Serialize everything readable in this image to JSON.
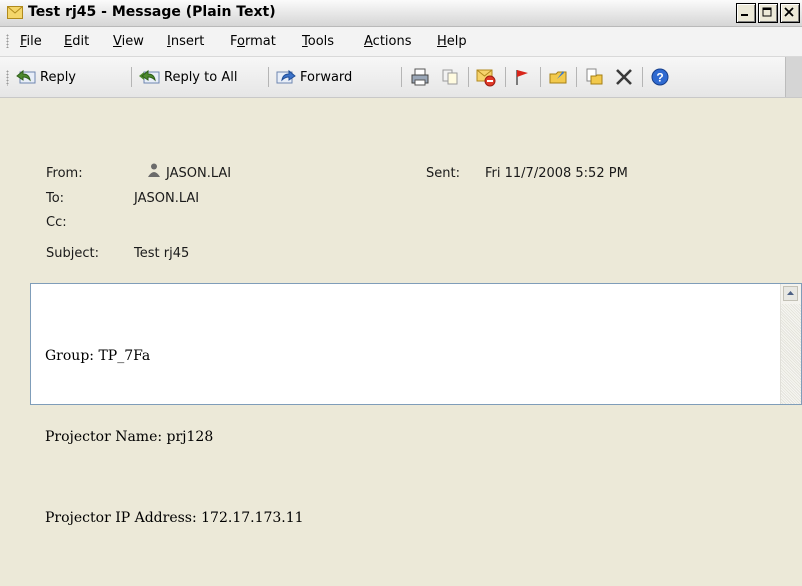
{
  "window": {
    "title": "Test rj45 - Message (Plain Text)",
    "controls": [
      "minimize",
      "maximize",
      "close"
    ]
  },
  "menu": [
    {
      "label": "File",
      "accel": "F"
    },
    {
      "label": "Edit",
      "accel": "E"
    },
    {
      "label": "View",
      "accel": "V"
    },
    {
      "label": "Insert",
      "accel": "I"
    },
    {
      "label": "Format",
      "accel": "o"
    },
    {
      "label": "Tools",
      "accel": "T"
    },
    {
      "label": "Actions",
      "accel": "A"
    },
    {
      "label": "Help",
      "accel": "H"
    }
  ],
  "toolbar": {
    "reply_label": "Reply",
    "reply_all_label": "Reply to All",
    "forward_label": "Forward",
    "icons": [
      "print-icon",
      "copy-icon",
      "delete-mark-icon",
      "flag-icon",
      "move-icon",
      "copy-to-folder-icon",
      "delete-x-icon",
      "help-icon"
    ]
  },
  "header": {
    "from_label": "From:",
    "from_value": "JASON.LAI",
    "sent_label": "Sent:",
    "sent_value": "Fri 11/7/2008 5:52 PM",
    "to_label": "To:",
    "to_value": "JASON.LAI",
    "cc_label": "Cc:",
    "cc_value": "",
    "subject_label": "Subject:",
    "subject_value": "Test rj45"
  },
  "body": {
    "lines": [
      "Group: TP_7Fa",
      "Projector Name: prj128",
      "Projector IP Address: 172.17.173.11"
    ]
  },
  "colors": {
    "chrome": "#ece9d8",
    "menu_bg": "#f3f3f3",
    "body_bg": "#ffffff",
    "border_blue": "#7f9db9"
  }
}
